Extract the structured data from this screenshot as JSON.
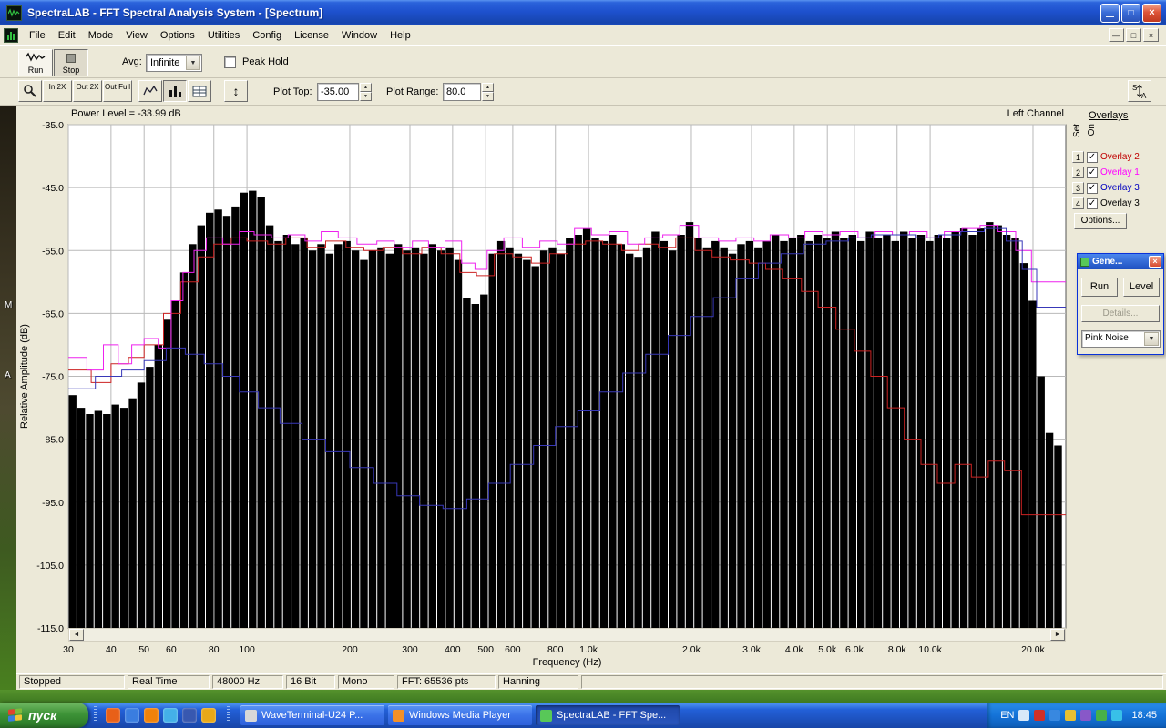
{
  "titlebar": {
    "title": "SpectraLAB - FFT Spectral Analysis System - [Spectrum]"
  },
  "menubar": {
    "items": [
      "File",
      "Edit",
      "Mode",
      "View",
      "Options",
      "Utilities",
      "Config",
      "License",
      "Window",
      "Help"
    ]
  },
  "toolbar": {
    "run": "Run",
    "stop": "Stop",
    "avg_label": "Avg:",
    "avg_value": "Infinite",
    "peak_hold": "Peak Hold",
    "zoom": [
      "In 2X",
      "Out 2X",
      "Out Full"
    ],
    "plot_top_label": "Plot Top:",
    "plot_top_value": "-35.00",
    "plot_range_label": "Plot Range:",
    "plot_range_value": "80.0"
  },
  "plot_header": {
    "power_level": "Power Level = -33.99 dB",
    "channel": "Left Channel"
  },
  "overlays_panel": {
    "title": "Overlays",
    "col_set": "Set",
    "col_on": "On",
    "items": [
      {
        "num": "1",
        "label": "Overlay 2",
        "color": "#c00000"
      },
      {
        "num": "2",
        "label": "Overlay 1",
        "color": "#ff00ff"
      },
      {
        "num": "3",
        "label": "Overlay 3",
        "color": "#0000c0"
      },
      {
        "num": "4",
        "label": "Overlay 3",
        "color": "#000000"
      }
    ],
    "options": "Options..."
  },
  "generator": {
    "title": "Gene...",
    "run": "Run",
    "level": "Level",
    "details": "Details...",
    "signal": "Pink Noise"
  },
  "statusbar": {
    "cells": [
      "Stopped",
      "Real Time",
      "48000 Hz",
      "16 Bit",
      "Mono",
      "FFT: 65536 pts",
      "Hanning"
    ]
  },
  "taskbar": {
    "start": "пуск",
    "tasks": [
      {
        "label": "WaveTerminal-U24 P...",
        "icon": "waveterminal-icon",
        "color": "#d8d8d8",
        "active": false
      },
      {
        "label": "Windows Media Player",
        "icon": "media-player-icon",
        "color": "#f49028",
        "active": false
      },
      {
        "label": "SpectraLAB - FFT Spe...",
        "icon": "spectralab-icon",
        "color": "#58c858",
        "active": true
      }
    ],
    "quicklaunch": [
      {
        "name": "firefox-icon",
        "color": "#e86018"
      },
      {
        "name": "ie-icon",
        "color": "#3a7de0"
      },
      {
        "name": "media-player-icon",
        "color": "#f0820a"
      },
      {
        "name": "messenger-icon",
        "color": "#44b0e8"
      },
      {
        "name": "outlook-icon",
        "color": "#3858b0"
      },
      {
        "name": "winamp-icon",
        "color": "#e8a818"
      }
    ],
    "tray_lang": "EN",
    "tray_icons": [
      {
        "name": "volume-icon",
        "color": "#d8e8f8"
      },
      {
        "name": "antivirus-icon",
        "color": "#d03028"
      },
      {
        "name": "network-icon",
        "color": "#3888e0"
      },
      {
        "name": "update-icon",
        "color": "#e8c030"
      },
      {
        "name": "display-icon",
        "color": "#8858c8"
      },
      {
        "name": "usb-icon",
        "color": "#48b048"
      },
      {
        "name": "messenger-tray-icon",
        "color": "#38c0e8"
      }
    ],
    "clock": "18:45"
  },
  "desktop": {
    "icon_fragments": [
      "M",
      "A"
    ]
  },
  "glyphs": {
    "minimize": "—",
    "maximize": "□",
    "close": "×",
    "check": "✓",
    "combo_arrow": "▼",
    "spin_up": "▲",
    "spin_down": "▼",
    "scroll_left": "◄",
    "scroll_right": "►",
    "fit_vertical": "↕"
  },
  "chart_data": {
    "type": "bar",
    "title": "Power Level = -33.99 dB",
    "xlabel": "Frequency (Hz)",
    "ylabel": "Relative Amplitude (dB)",
    "x_scale": "log",
    "xlim": [
      30,
      24950
    ],
    "ylim": [
      -115,
      -35
    ],
    "yticks": [
      {
        "v": -35,
        "label": "-35.0"
      },
      {
        "v": -45,
        "label": "-45.0"
      },
      {
        "v": -55,
        "label": "-55.0"
      },
      {
        "v": -65,
        "label": "-65.0"
      },
      {
        "v": -75,
        "label": "-75.0"
      },
      {
        "v": -85,
        "label": "-85.0"
      },
      {
        "v": -95,
        "label": "-95.0"
      },
      {
        "v": -105,
        "label": "-105.0"
      },
      {
        "v": -115,
        "label": "-115.0"
      }
    ],
    "xticks": [
      {
        "f": 30,
        "label": "30"
      },
      {
        "f": 40,
        "label": "40"
      },
      {
        "f": 50,
        "label": "50"
      },
      {
        "f": 60,
        "label": "60"
      },
      {
        "f": 80,
        "label": "80"
      },
      {
        "f": 100,
        "label": "100"
      },
      {
        "f": 200,
        "label": "200"
      },
      {
        "f": 300,
        "label": "300"
      },
      {
        "f": 400,
        "label": "400"
      },
      {
        "f": 500,
        "label": "500"
      },
      {
        "f": 600,
        "label": "600"
      },
      {
        "f": 800,
        "label": "800"
      },
      {
        "f": 1000,
        "label": "1.0k"
      },
      {
        "f": 2000,
        "label": "2.0k"
      },
      {
        "f": 3000,
        "label": "3.0k"
      },
      {
        "f": 4000,
        "label": "4.0k"
      },
      {
        "f": 5000,
        "label": "5.0k"
      },
      {
        "f": 6000,
        "label": "6.0k"
      },
      {
        "f": 8000,
        "label": "8.0k"
      },
      {
        "f": 10000,
        "label": "10.0k"
      },
      {
        "f": 20000,
        "label": "20.0k"
      }
    ],
    "bars_f0": 30,
    "bars_per_octave": 12,
    "bars_db": [
      -78,
      -80,
      -81,
      -80.5,
      -81,
      -79.5,
      -80,
      -78.5,
      -76,
      -73.5,
      -70,
      -66,
      -63,
      -58.5,
      -54,
      -51,
      -49,
      -48.5,
      -49.5,
      -48,
      -45.8,
      -45.5,
      -46.5,
      -51,
      -53.5,
      -52.5,
      -54,
      -53,
      -55,
      -54,
      -55.5,
      -54,
      -53.5,
      -55,
      -56.5,
      -55,
      -54.5,
      -55.5,
      -54,
      -55,
      -54.5,
      -55.5,
      -54,
      -55,
      -54.5,
      -56.5,
      -62.5,
      -63.5,
      -62,
      -55.5,
      -53.5,
      -54.5,
      -55.5,
      -56.5,
      -57.5,
      -55,
      -54.5,
      -55.5,
      -53,
      -52.5,
      -51.5,
      -53,
      -53.5,
      -52.5,
      -54,
      -55.5,
      -56,
      -54.5,
      -52,
      -53.5,
      -55,
      -52.5,
      -50.5,
      -53,
      -54.5,
      -53.5,
      -54.5,
      -55.5,
      -54,
      -53.5,
      -54.5,
      -53.5,
      -52.5,
      -53.5,
      -53,
      -52.5,
      -53.5,
      -52.5,
      -53,
      -52,
      -53,
      -52.5,
      -53.5,
      -52,
      -53,
      -52.5,
      -53.5,
      -52,
      -53,
      -52.5,
      -53.5,
      -52.5,
      -53,
      -52,
      -51.5,
      -52.5,
      -51.5,
      -50.5,
      -51,
      -52.5,
      -53,
      -57,
      -63,
      -75,
      -84,
      -86
    ],
    "overlays": [
      {
        "name": "Overlay 2",
        "color": "#cc2222",
        "points": [
          [
            30,
            -74
          ],
          [
            35,
            -76
          ],
          [
            40,
            -73
          ],
          [
            45,
            -72
          ],
          [
            50,
            -70
          ],
          [
            57,
            -65
          ],
          [
            64,
            -60
          ],
          [
            72,
            -56
          ],
          [
            80,
            -54
          ],
          [
            90,
            -53
          ],
          [
            100,
            -53.5
          ],
          [
            115,
            -54
          ],
          [
            130,
            -53
          ],
          [
            150,
            -54.5
          ],
          [
            170,
            -53.5
          ],
          [
            195,
            -54.5
          ],
          [
            220,
            -55
          ],
          [
            250,
            -54.5
          ],
          [
            285,
            -55.5
          ],
          [
            325,
            -54.5
          ],
          [
            370,
            -55.5
          ],
          [
            420,
            -58.5
          ],
          [
            470,
            -59
          ],
          [
            530,
            -55.5
          ],
          [
            600,
            -56
          ],
          [
            680,
            -57
          ],
          [
            770,
            -55.5
          ],
          [
            870,
            -54
          ],
          [
            980,
            -53.5
          ],
          [
            1100,
            -54
          ],
          [
            1250,
            -55
          ],
          [
            1400,
            -54
          ],
          [
            1600,
            -54.5
          ],
          [
            1800,
            -53
          ],
          [
            2050,
            -55
          ],
          [
            2300,
            -56
          ],
          [
            2600,
            -56.5
          ],
          [
            2950,
            -57
          ],
          [
            3300,
            -58
          ],
          [
            3700,
            -59.5
          ],
          [
            4200,
            -61.5
          ],
          [
            4700,
            -64
          ],
          [
            5300,
            -67.5
          ],
          [
            6000,
            -71
          ],
          [
            6700,
            -75
          ],
          [
            7500,
            -80
          ],
          [
            8400,
            -85
          ],
          [
            9400,
            -89
          ],
          [
            10500,
            -92
          ],
          [
            11800,
            -89
          ],
          [
            13200,
            -91
          ],
          [
            14800,
            -88.5
          ],
          [
            16500,
            -90
          ],
          [
            18500,
            -97
          ]
        ]
      },
      {
        "name": "Overlay 1",
        "color": "#ee22ee",
        "points": [
          [
            30,
            -72
          ],
          [
            34,
            -74
          ],
          [
            38,
            -70
          ],
          [
            42,
            -73
          ],
          [
            46,
            -70
          ],
          [
            50,
            -69
          ],
          [
            55,
            -70.5
          ],
          [
            60,
            -63
          ],
          [
            65,
            -58.5
          ],
          [
            70,
            -55
          ],
          [
            76,
            -53
          ],
          [
            85,
            -54
          ],
          [
            95,
            -52
          ],
          [
            105,
            -52.5
          ],
          [
            118,
            -53
          ],
          [
            132,
            -52.5
          ],
          [
            148,
            -53.5
          ],
          [
            165,
            -52
          ],
          [
            185,
            -53
          ],
          [
            210,
            -54
          ],
          [
            240,
            -53.5
          ],
          [
            270,
            -54.5
          ],
          [
            305,
            -53.5
          ],
          [
            340,
            -54.5
          ],
          [
            380,
            -53.5
          ],
          [
            425,
            -57
          ],
          [
            465,
            -58
          ],
          [
            505,
            -55
          ],
          [
            565,
            -53
          ],
          [
            640,
            -54.5
          ],
          [
            720,
            -53.5
          ],
          [
            810,
            -54
          ],
          [
            910,
            -51.5
          ],
          [
            1020,
            -52.5
          ],
          [
            1150,
            -52
          ],
          [
            1300,
            -54
          ],
          [
            1460,
            -53
          ],
          [
            1650,
            -52.5
          ],
          [
            1850,
            -51
          ],
          [
            2100,
            -53
          ],
          [
            2400,
            -53.5
          ],
          [
            2700,
            -53
          ],
          [
            3050,
            -53.5
          ],
          [
            3400,
            -52.5
          ],
          [
            3850,
            -53
          ],
          [
            4300,
            -52
          ],
          [
            4850,
            -52.5
          ],
          [
            5450,
            -52
          ],
          [
            6150,
            -53
          ],
          [
            6900,
            -52
          ],
          [
            7750,
            -52.5
          ],
          [
            8700,
            -52
          ],
          [
            9800,
            -53
          ],
          [
            11000,
            -52
          ],
          [
            12400,
            -51.5
          ],
          [
            14000,
            -51
          ],
          [
            15800,
            -52
          ],
          [
            17800,
            -55
          ],
          [
            19800,
            -60
          ]
        ]
      },
      {
        "name": "Overlay 3",
        "color": "#3838b8",
        "points": [
          [
            30,
            -77
          ],
          [
            36,
            -75
          ],
          [
            43,
            -74
          ],
          [
            50,
            -72.5
          ],
          [
            58,
            -70.5
          ],
          [
            66,
            -71.5
          ],
          [
            75,
            -73
          ],
          [
            85,
            -75
          ],
          [
            95,
            -77.5
          ],
          [
            108,
            -80
          ],
          [
            125,
            -82.5
          ],
          [
            145,
            -85
          ],
          [
            170,
            -87
          ],
          [
            200,
            -89.5
          ],
          [
            235,
            -92
          ],
          [
            275,
            -94
          ],
          [
            320,
            -95.5
          ],
          [
            375,
            -96
          ],
          [
            440,
            -94.5
          ],
          [
            510,
            -92
          ],
          [
            590,
            -89
          ],
          [
            690,
            -86
          ],
          [
            800,
            -83
          ],
          [
            930,
            -80.5
          ],
          [
            1080,
            -77.5
          ],
          [
            1260,
            -74.5
          ],
          [
            1470,
            -71.5
          ],
          [
            1710,
            -68.5
          ],
          [
            1990,
            -65.5
          ],
          [
            2320,
            -62.5
          ],
          [
            2700,
            -59.5
          ],
          [
            3140,
            -57
          ],
          [
            3660,
            -55.5
          ],
          [
            4260,
            -54
          ],
          [
            4960,
            -53.5
          ],
          [
            5770,
            -53
          ],
          [
            6720,
            -52.5
          ],
          [
            7820,
            -52.5
          ],
          [
            9100,
            -53
          ],
          [
            10600,
            -52.5
          ],
          [
            12300,
            -52
          ],
          [
            14400,
            -51.5
          ],
          [
            16700,
            -53.5
          ],
          [
            18600,
            -58
          ],
          [
            20500,
            -64
          ]
        ]
      }
    ]
  }
}
